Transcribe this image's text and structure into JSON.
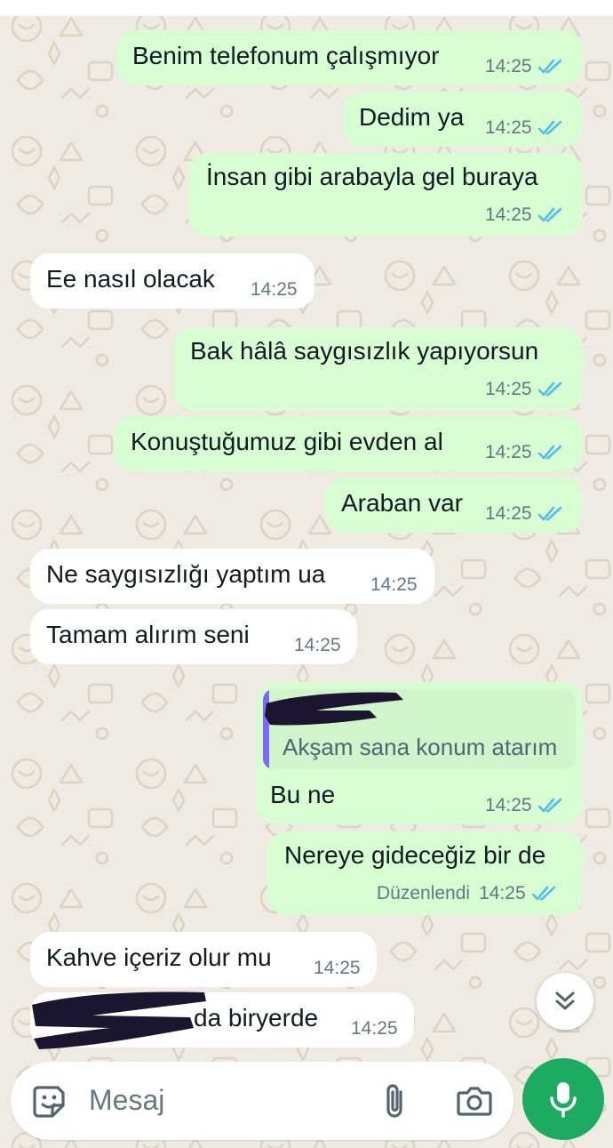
{
  "chat": {
    "messages": [
      {
        "dir": "out",
        "text": "Benim telefonum çalışmıyor",
        "time": "14:25",
        "ticks": true
      },
      {
        "dir": "out",
        "text": "Dedim ya",
        "time": "14:25",
        "ticks": true
      },
      {
        "dir": "out",
        "text": "İnsan gibi arabayla gel buraya",
        "time": "14:25",
        "ticks": true
      },
      {
        "dir": "in",
        "text": "Ee nasıl olacak",
        "time": "14:25"
      },
      {
        "dir": "out",
        "text": "Bak hâlâ saygısızlık yapıyorsun",
        "time": "14:25",
        "ticks": true
      },
      {
        "dir": "out",
        "text": "Konuştuğumuz gibi evden al",
        "time": "14:25",
        "ticks": true
      },
      {
        "dir": "out",
        "text": "Araban var",
        "time": "14:25",
        "ticks": true
      },
      {
        "dir": "in",
        "text": "Ne saygısızlığı yaptım ua",
        "time": "14:25"
      },
      {
        "dir": "in",
        "text": "Tamam alırım seni",
        "time": "14:25"
      },
      {
        "dir": "out",
        "text": "Bu ne",
        "time": "14:25",
        "ticks": true,
        "quote": {
          "text": "Akşam sana konum atarım",
          "author_redacted": true
        }
      },
      {
        "dir": "out",
        "text": "Nereye gideceğiz bir de",
        "time": "14:25",
        "ticks": true,
        "edited": "Düzenlendi"
      },
      {
        "dir": "in",
        "text": "Kahve içeriz olur mu",
        "time": "14:25"
      },
      {
        "dir": "in",
        "text": "da biryerde",
        "time": "14:25",
        "redacted_prefix": true
      }
    ]
  },
  "composer": {
    "placeholder": "Mesaj",
    "icons": {
      "emoji": "sticker-icon",
      "attach": "paperclip-icon",
      "camera": "camera-icon",
      "mic": "microphone-icon",
      "scroll": "double-chevron-down-icon"
    }
  },
  "colors": {
    "background": "#efeae2",
    "outgoing_bubble": "#d9fdd3",
    "incoming_bubble": "#ffffff",
    "read_ticks": "#53bdeb",
    "accent_green": "#1daa61",
    "quote_bar": "#7f66ff",
    "redaction": "#1c1530"
  }
}
